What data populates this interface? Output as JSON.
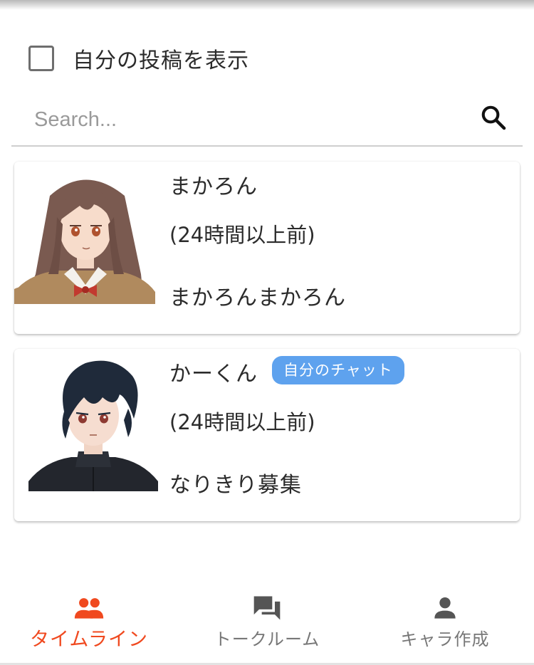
{
  "filter": {
    "label": "自分の投稿を表示",
    "checked": false
  },
  "search": {
    "placeholder": "Search..."
  },
  "posts": [
    {
      "name": "まかろん",
      "time": "(24時間以上前)",
      "message": "まかろんまかろん",
      "badge": ""
    },
    {
      "name": "かーくん",
      "time": "(24時間以上前)",
      "message": "なりきり募集",
      "badge": "自分のチャット"
    }
  ],
  "bottom_nav": {
    "items": [
      {
        "label": "タイムライン",
        "icon": "people-icon",
        "active": true
      },
      {
        "label": "トークルーム",
        "icon": "forum-icon",
        "active": false
      },
      {
        "label": "キャラ作成",
        "icon": "person-icon",
        "active": false
      }
    ]
  },
  "colors": {
    "accent": "#f0491f",
    "badge": "#5ea2ee",
    "inactive": "#777777"
  }
}
